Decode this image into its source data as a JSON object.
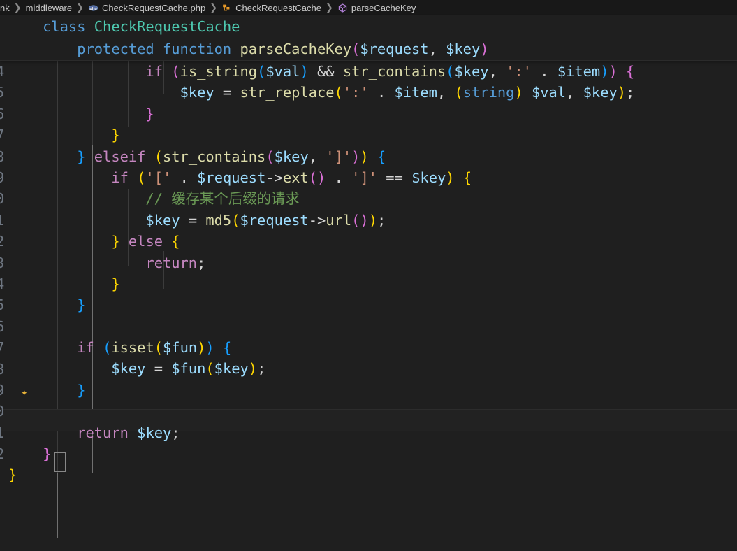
{
  "breadcrumb": {
    "items": [
      {
        "label": "nk",
        "icon": ""
      },
      {
        "label": "middleware",
        "icon": "folder-icon"
      },
      {
        "label": "CheckRequestCache.php",
        "icon": "php-file-icon"
      },
      {
        "label": "CheckRequestCache",
        "icon": "symbol-class-icon"
      },
      {
        "label": "parseCacheKey",
        "icon": "symbol-method-icon"
      }
    ],
    "separator": "❯"
  },
  "sticky_scroll": {
    "lines": [
      {
        "text": "    class CheckRequestCache",
        "name": "sticky-class-line"
      },
      {
        "text": "        protected function parseCacheKey($request, $key)",
        "name": "sticky-method-line"
      }
    ]
  },
  "editor": {
    "language": "php",
    "theme": "Dark Modern",
    "cursor_line_index": 16,
    "gutter_digit_hints": [
      "4",
      "5",
      "6",
      "7",
      "8",
      "9",
      "0",
      "1",
      "2",
      "3",
      "4",
      "5",
      "6",
      "7",
      "8",
      "9",
      "0",
      "1",
      "2"
    ],
    "copilot_glyph": "✦",
    "lines": [
      "                if (is_string($val) && str_contains($key, ':' . $item)) {",
      "                    $key = str_replace(':' . $item, (string) $val, $key);",
      "                }",
      "            }",
      "        } elseif (str_contains($key, ']')) {",
      "            if ('[' . $request->ext() . ']' == $key) {",
      "                // 缓存某个后缀的请求",
      "                $key = md5($request->url());",
      "            } else {",
      "                return;",
      "            }",
      "        }",
      "",
      "        if (isset($fun)) {",
      "            $key = $fun($key);",
      "        }",
      "",
      "        return $key;",
      "    }",
      "}"
    ],
    "comment_text": "// 缓存某个后缀的请求"
  },
  "colors": {
    "background": "#1f1f1f",
    "breadcrumb_background": "#181818",
    "keyword_control": "#c586c0",
    "keyword_other": "#569cd6",
    "class_name": "#4ec9b0",
    "function_name": "#dcdcaa",
    "variable": "#9cdcfe",
    "string": "#ce9178",
    "comment": "#6a9955",
    "bracket_level_1": "#ffd700",
    "bracket_level_2": "#da70d6",
    "bracket_level_3": "#179fff",
    "copilot_sparkle": "#e8b339"
  }
}
